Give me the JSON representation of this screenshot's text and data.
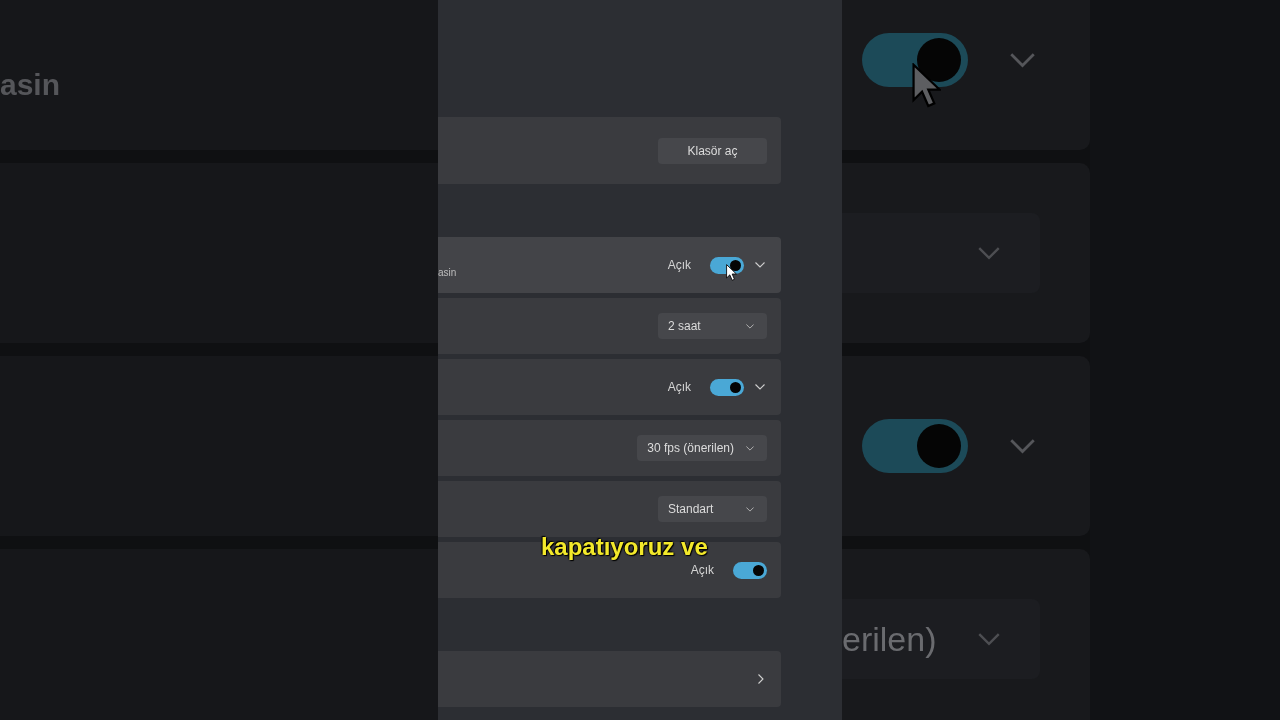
{
  "background_left": {
    "subtitle": "asin"
  },
  "settings": {
    "groups": [
      {
        "rows": [
          {
            "kind": "button",
            "label": "Klasör aç"
          }
        ]
      },
      {
        "rows": [
          {
            "kind": "toggle",
            "subtitle": "asin",
            "state": "Açık",
            "on": true,
            "expandable": true,
            "hovered": true
          },
          {
            "kind": "dropdown",
            "value": "2 saat"
          },
          {
            "kind": "toggle",
            "state": "Açık",
            "on": true,
            "expandable": true
          },
          {
            "kind": "dropdown",
            "value": "30 fps (önerilen)"
          },
          {
            "kind": "dropdown",
            "value": "Standart"
          },
          {
            "kind": "toggle",
            "state": "Açık",
            "on": true,
            "expandable": false
          }
        ]
      },
      {
        "rows": [
          {
            "kind": "link"
          }
        ]
      }
    ]
  },
  "caption": "kapatıyoruz ve",
  "background_right": {
    "rows": [
      {
        "kind": "toggle",
        "on": true,
        "expandable": true,
        "hovered": true
      },
      {
        "kind": "dropdown"
      },
      {
        "kind": "toggle",
        "on": true,
        "expandable": true
      },
      {
        "kind": "dropdown",
        "value": "erilen)"
      }
    ]
  }
}
